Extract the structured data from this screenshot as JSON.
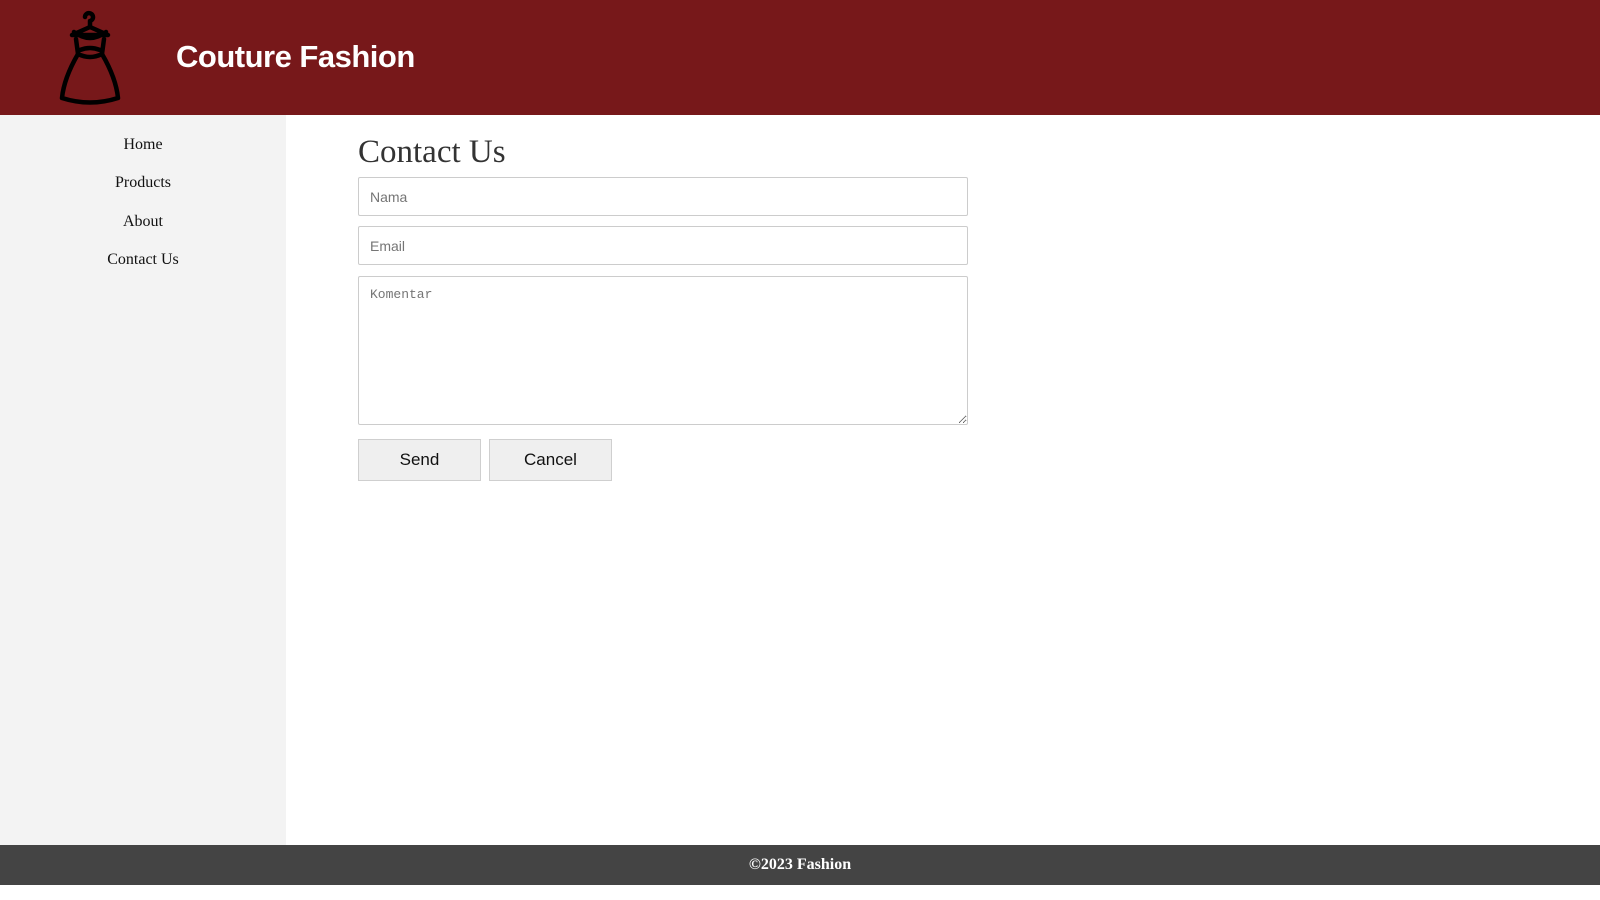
{
  "header": {
    "logo_icon": "dress-hanger-icon",
    "title": "Couture Fashion",
    "background_color": "#77181a"
  },
  "sidebar": {
    "items": [
      {
        "label": "Home"
      },
      {
        "label": "Products"
      },
      {
        "label": "About"
      },
      {
        "label": "Contact Us"
      }
    ]
  },
  "main": {
    "title": "Contact Us",
    "form": {
      "name_placeholder": "Nama",
      "email_placeholder": "Email",
      "comment_placeholder": "Komentar",
      "send_label": "Send",
      "cancel_label": "Cancel"
    }
  },
  "footer": {
    "text": "©2023 Fashion"
  }
}
